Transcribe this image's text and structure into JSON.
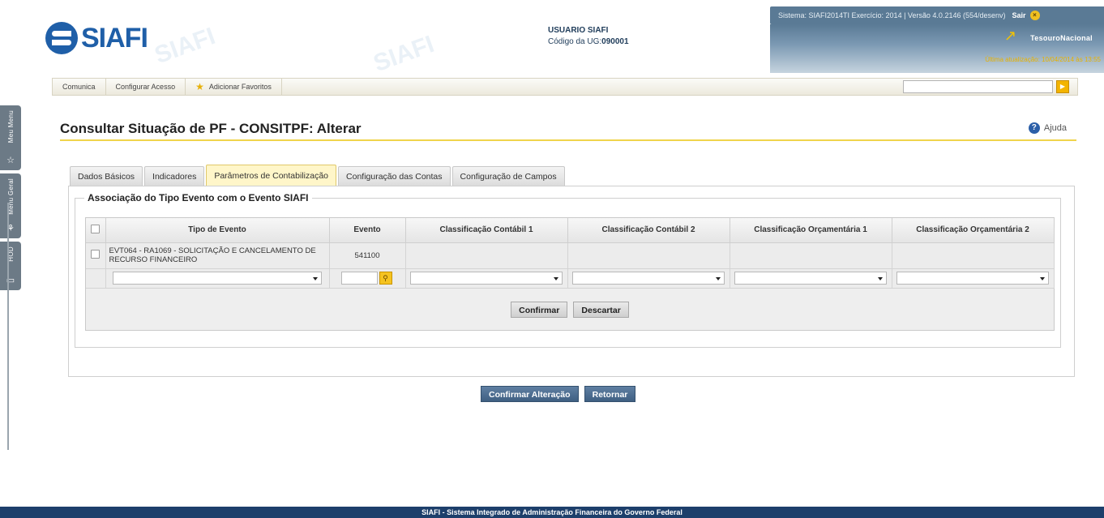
{
  "header": {
    "system_info": "Sistema: SIAFI2014TI Exercício: 2014 | Versão 4.0.2146 (554/desenv)",
    "logout_label": "Sair",
    "logo_text": "SIAFI",
    "user_name": "USUARIO SIAFI",
    "ug_label": "Código da UG:",
    "ug_value": "090001",
    "tesouro_label": "TesouroNacional",
    "last_update": "Última atualização: 10/04/2014 às 13:55"
  },
  "side_tabs": [
    "Meu Menu",
    "Menu Geral",
    "HOD"
  ],
  "menubar": {
    "items": [
      "Comunica",
      "Configurar Acesso",
      "Adicionar Favoritos"
    ],
    "search_value": ""
  },
  "page": {
    "title": "Consultar Situação de PF - CONSITPF: Alterar",
    "help_label": "Ajuda"
  },
  "tabs": [
    {
      "label": "Dados Básicos",
      "active": false
    },
    {
      "label": "Indicadores",
      "active": false
    },
    {
      "label": "Parâmetros de Contabilização",
      "active": true
    },
    {
      "label": "Configuração das Contas",
      "active": false
    },
    {
      "label": "Configuração de Campos",
      "active": false
    }
  ],
  "section": {
    "legend": "Associação do Tipo Evento com o Evento SIAFI",
    "columns": [
      "Tipo de Evento",
      "Evento",
      "Classificação Contábil 1",
      "Classificação Contábil 2",
      "Classificação Orçamentária 1",
      "Classificação Orçamentária 2"
    ],
    "rows": [
      {
        "tipo_evento": "EVT064 - RA1069 - SOLICITAÇÃO E CANCELAMENTO DE RECURSO FINANCEIRO",
        "evento": "541100",
        "cc1": "",
        "cc2": "",
        "co1": "",
        "co2": ""
      }
    ],
    "confirm_label": "Confirmar",
    "discard_label": "Descartar"
  },
  "actions": {
    "confirm_change_label": "Confirmar Alteração",
    "return_label": "Retornar"
  },
  "footer": {
    "text": "SIAFI - Sistema Integrado de Administração Financeira do Governo Federal"
  },
  "colors": {
    "brand_blue": "#1f5fa8",
    "header_band": "#5a7a95",
    "accent_yellow": "#f5c320",
    "footer_bg": "#1d3f6b"
  }
}
